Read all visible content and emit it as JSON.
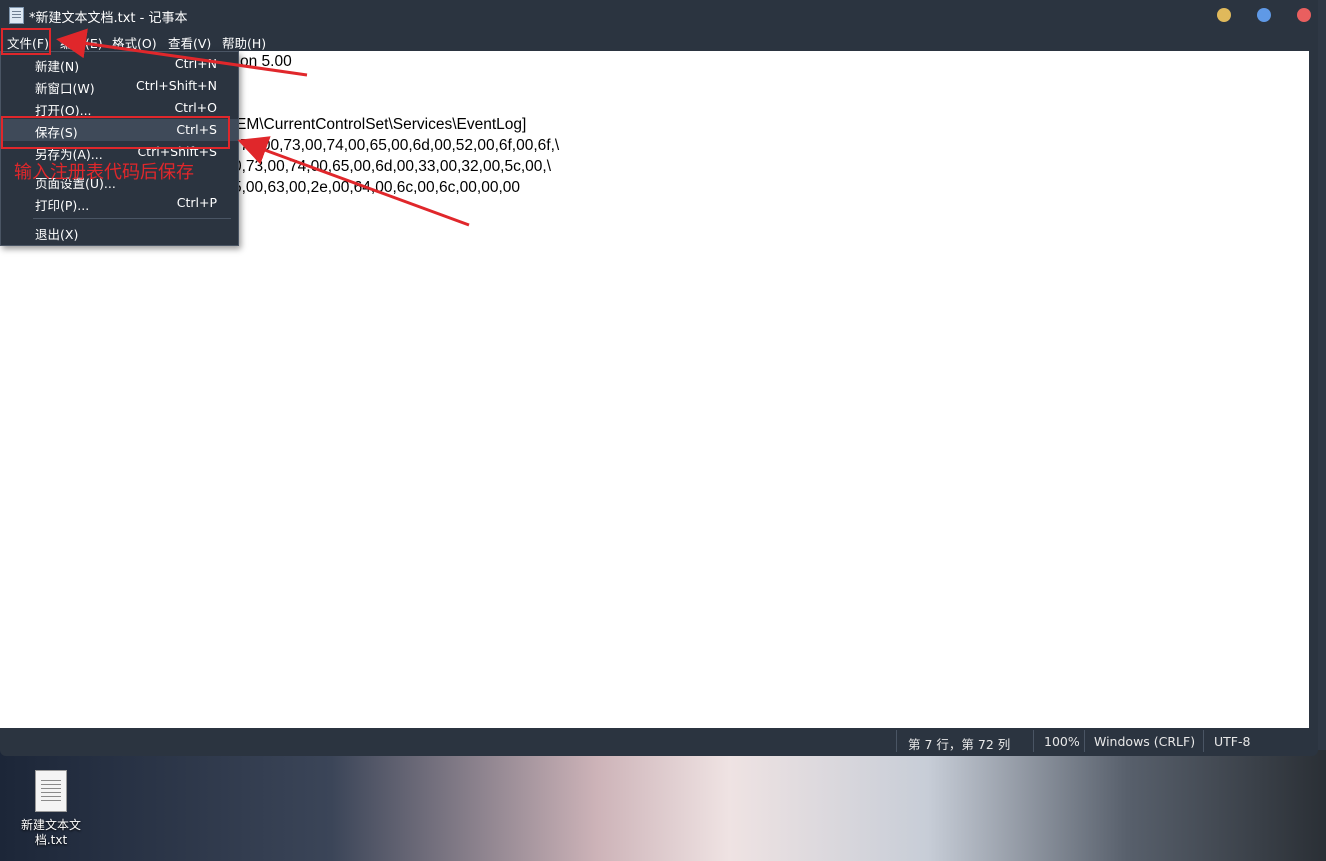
{
  "window": {
    "title": "*新建文本文档.txt - 记事本",
    "controls_colors": [
      "#e0b95b",
      "#5f99e6",
      "#e95f5f"
    ]
  },
  "menubar": {
    "items": [
      "文件(F)",
      "编辑(E)",
      "格式(O)",
      "查看(V)",
      "帮助(H)"
    ]
  },
  "file_menu": {
    "items": [
      {
        "label": "新建(N)",
        "shortcut": "Ctrl+N"
      },
      {
        "label": "新窗口(W)",
        "shortcut": "Ctrl+Shift+N"
      },
      {
        "label": "打开(O)...",
        "shortcut": "Ctrl+O"
      },
      {
        "label": "保存(S)",
        "shortcut": "Ctrl+S"
      },
      {
        "label": "另存为(A)...",
        "shortcut": "Ctrl+Shift+S"
      },
      {
        "label": "页面设置(U)...",
        "shortcut": ""
      },
      {
        "label": "打印(P)...",
        "shortcut": "Ctrl+P"
      },
      {
        "label": "退出(X)",
        "shortcut": ""
      }
    ]
  },
  "editor": {
    "visible_lines": [
      "on 5.00",
      "EM\\CurrentControlSet\\Services\\EventLog]",
      ",73,00,73,00,74,00,65,00,6d,00,52,00,6f,00,6f,\\",
      "0,73,00,74,00,65,00,6d,00,33,00,32,00,5c,00,\\",
      "5,00,63,00,2e,00,64,00,6c,00,6c,00,00,00"
    ]
  },
  "statusbar": {
    "position": "第 7 行，第 72 列",
    "zoom": "100%",
    "line_ending": "Windows (CRLF)",
    "encoding": "UTF-8"
  },
  "annotation": {
    "text": "输入注册表代码后保存",
    "color": "#e0272b"
  },
  "desktop": {
    "icon_label_line1": "新建文本文",
    "icon_label_line2": "档.txt"
  }
}
